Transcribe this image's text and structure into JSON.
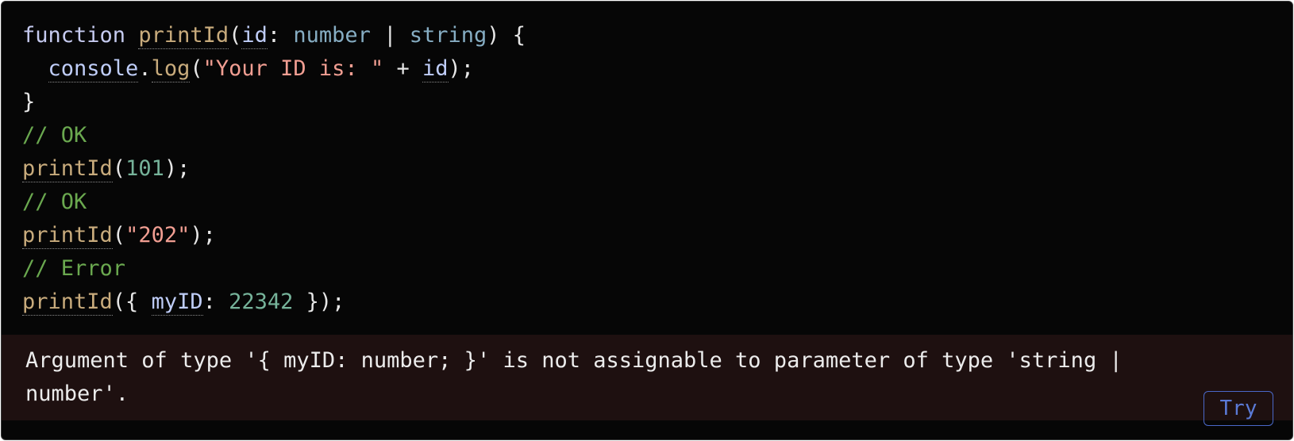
{
  "code": {
    "lines": [
      [
        {
          "t": "function",
          "c": "kw"
        },
        {
          "t": " ",
          "c": "pl"
        },
        {
          "t": "printId",
          "c": "fn",
          "u": true
        },
        {
          "t": "(",
          "c": "pl"
        },
        {
          "t": "id",
          "c": "vr",
          "u": true
        },
        {
          "t": ": ",
          "c": "pl"
        },
        {
          "t": "number",
          "c": "ty"
        },
        {
          "t": " | ",
          "c": "pl"
        },
        {
          "t": "string",
          "c": "ty"
        },
        {
          "t": ") {",
          "c": "pl"
        }
      ],
      [
        {
          "t": "  ",
          "c": "pl"
        },
        {
          "t": "console",
          "c": "vr",
          "u": true
        },
        {
          "t": ".",
          "c": "pl"
        },
        {
          "t": "log",
          "c": "fn",
          "u": true
        },
        {
          "t": "(",
          "c": "pl"
        },
        {
          "t": "\"Your ID is: \"",
          "c": "st"
        },
        {
          "t": " + ",
          "c": "pl"
        },
        {
          "t": "id",
          "c": "vr",
          "u": true
        },
        {
          "t": ");",
          "c": "pl"
        }
      ],
      [
        {
          "t": "}",
          "c": "pl"
        }
      ],
      [
        {
          "t": "// OK",
          "c": "cm"
        }
      ],
      [
        {
          "t": "printId",
          "c": "fn",
          "u": true
        },
        {
          "t": "(",
          "c": "pl"
        },
        {
          "t": "101",
          "c": "nm"
        },
        {
          "t": ");",
          "c": "pl"
        }
      ],
      [
        {
          "t": "// OK",
          "c": "cm"
        }
      ],
      [
        {
          "t": "printId",
          "c": "fn",
          "u": true
        },
        {
          "t": "(",
          "c": "pl"
        },
        {
          "t": "\"202\"",
          "c": "st"
        },
        {
          "t": ");",
          "c": "pl"
        }
      ],
      [
        {
          "t": "// Error",
          "c": "cm"
        }
      ],
      [
        {
          "t": "printId",
          "c": "fn",
          "u": true
        },
        {
          "t": "({ ",
          "c": "pl"
        },
        {
          "t": "myID",
          "c": "vr",
          "u": true
        },
        {
          "t": ": ",
          "c": "pl"
        },
        {
          "t": "22342",
          "c": "nm"
        },
        {
          "t": " });",
          "c": "pl"
        }
      ]
    ]
  },
  "error": {
    "message": "Argument of type '{ myID: number; }' is not assignable to parameter of type 'string | number'."
  },
  "actions": {
    "try_label": "Try"
  },
  "colors": {
    "background": "#060606",
    "keyword": "#c6cbf0",
    "function": "#c8ab7c",
    "variable": "#bfcdf8",
    "type": "#86adc3",
    "string": "#f19e92",
    "number": "#76b39a",
    "comment": "#6aa84f",
    "error_background": "#1e1010",
    "button_accent": "#4a68c8"
  }
}
